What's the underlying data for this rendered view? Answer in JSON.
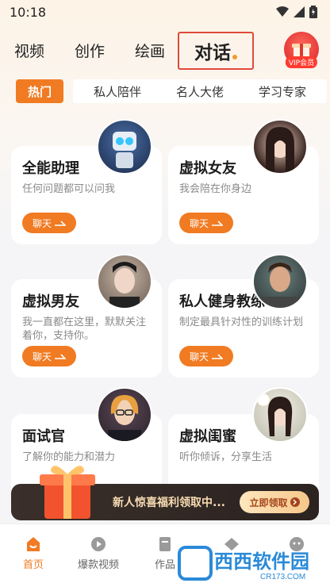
{
  "status": {
    "time": "10:18"
  },
  "top_tabs": [
    {
      "label": "视频"
    },
    {
      "label": "创作"
    },
    {
      "label": "绘画"
    },
    {
      "label": "对话"
    }
  ],
  "vip": {
    "label": "VIP会员"
  },
  "categories": [
    "热门",
    "私人陪伴",
    "名人大佬",
    "学习专家"
  ],
  "cards": [
    {
      "title": "全能助理",
      "desc": "任何问题都可以问我",
      "button": "聊天"
    },
    {
      "title": "虚拟女友",
      "desc": "我会陪在你身边",
      "button": "聊天"
    },
    {
      "title": "虚拟男友",
      "desc": "我一直都在这里，默默关注着你，支持你。",
      "button": "聊天"
    },
    {
      "title": "私人健身教练",
      "desc": "制定最具针对性的训练计划",
      "button": "聊天"
    },
    {
      "title": "面试官",
      "desc": "了解你的能力和潜力",
      "button": "聊天"
    },
    {
      "title": "虚拟闺蜜",
      "desc": "听你倾诉，分享生活",
      "button": "聊天"
    }
  ],
  "banner": {
    "text": "新人惊喜福利领取中...",
    "button": "立即领取"
  },
  "bottom_nav": [
    {
      "label": "首页"
    },
    {
      "label": "爆款视频"
    },
    {
      "label": "作品"
    }
  ],
  "watermark": {
    "text": "西西软件园",
    "url": "CR173.COM"
  },
  "colors": {
    "accent": "#f07b22",
    "highlight_border": "#e04a3a",
    "banner_bg": "#2b2320"
  }
}
